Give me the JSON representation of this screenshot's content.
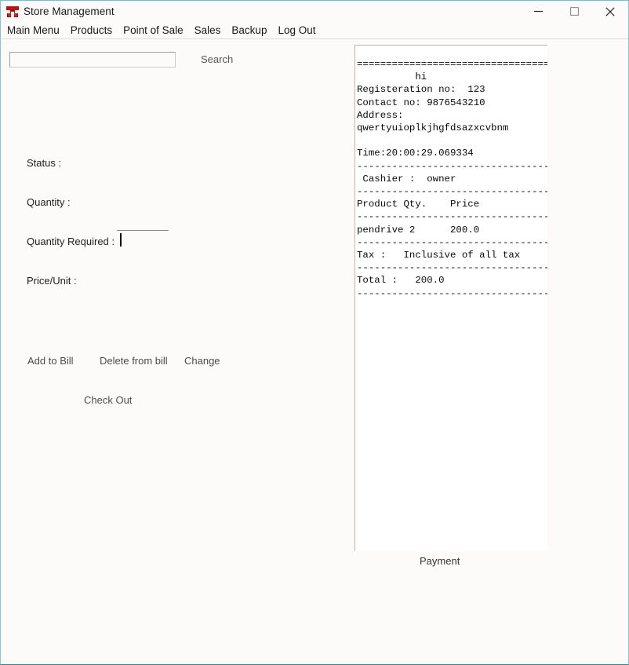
{
  "window": {
    "title": "Store Management",
    "icon": "store-icon",
    "border_color": "#7fc4dd",
    "background": "#fdfbfa",
    "controls": [
      {
        "name": "minimize-button",
        "glyph": "minimize"
      },
      {
        "name": "maximize-button",
        "glyph": "maximize"
      },
      {
        "name": "close-button",
        "glyph": "close"
      }
    ]
  },
  "menubar": {
    "items": [
      {
        "label": "Main Menu"
      },
      {
        "label": "Products"
      },
      {
        "label": "Point of Sale"
      },
      {
        "label": "Sales"
      },
      {
        "label": "Backup"
      },
      {
        "label": "Log Out"
      }
    ]
  },
  "form": {
    "search": {
      "value": "",
      "placeholder": "",
      "button_label": "Search"
    },
    "fields": [
      {
        "label": "Status :",
        "value": ""
      },
      {
        "label": "Quantity :",
        "value": ""
      },
      {
        "label": "Quantity Required :",
        "value": ""
      },
      {
        "label": "Price/Unit :",
        "value": ""
      }
    ],
    "quantity_required_value": "",
    "buttons": [
      {
        "label": "Add to Bill"
      },
      {
        "label": "Delete from bill"
      },
      {
        "label": "Change"
      },
      {
        "label": "Check Out"
      }
    ]
  },
  "receipt": {
    "store_name": "hi",
    "registration_no": "123",
    "contact_no": "9876543210",
    "address": "qwertyuioplkjhgfdsazxcvbnm",
    "time": "20:00:29.069334",
    "cashier": "owner",
    "columns": [
      "Product",
      "Qty.",
      "Price"
    ],
    "items": [
      {
        "product": "pendrive",
        "qty": "2",
        "price": "200.0"
      }
    ],
    "tax": "Inclusive of all tax",
    "total": "200.0",
    "text": "=================================\n          hi\nRegisteration no:  123\nContact no: 9876543210\nAddress:\nqwertyuioplkjhgfdsazxcvbnm\n\nTime:20:00:29.069334\n---------------------------------\n Cashier :  owner\n---------------------------------\nProduct Qty.    Price\n---------------------------------\npendrive 2      200.0\n---------------------------------\nTax :   Inclusive of all tax\n---------------------------------\nTotal :   200.0\n---------------------------------"
  },
  "payment": {
    "label": "Payment"
  }
}
